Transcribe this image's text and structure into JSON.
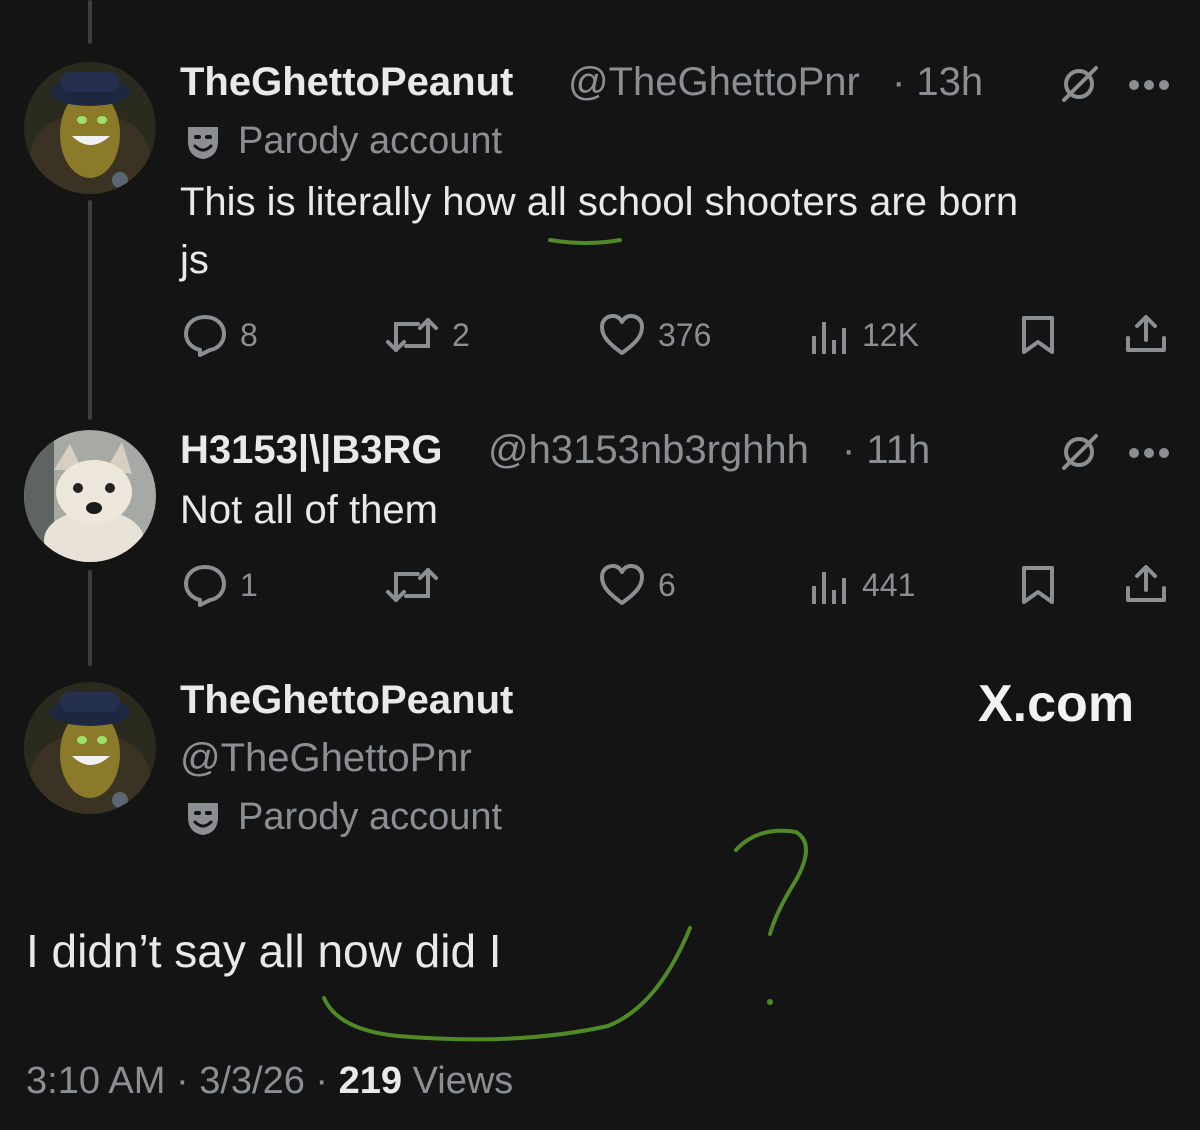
{
  "tweet1": {
    "name": "TheGhettoPeanut",
    "handle": "@TheGhettoPnr",
    "time": "· 13h",
    "label": "Parody account",
    "text_line1": "This is literally how all school shooters are born",
    "text_line2": "js",
    "replies": "8",
    "reposts": "2",
    "likes": "376",
    "views": "12K"
  },
  "tweet2": {
    "name": "H3153|\\|B3RG",
    "handle": "@h3153nb3rghhh",
    "time": "· 11h",
    "text": "Not all of them",
    "replies": "1",
    "reposts": "",
    "likes": "6",
    "views": "441"
  },
  "tweet3": {
    "name": "TheGhettoPeanut",
    "handle": "@TheGhettoPnr",
    "label": "Parody account",
    "text": "I didn’t say all now did I",
    "timestamp": "3:10 AM · 3/3/26 ·",
    "views_count": "219",
    "views_label": "Views"
  },
  "watermark": "X.com",
  "annotation_color": "#4f8a25",
  "icons": [
    "grok-icon",
    "more-icon",
    "reply-icon",
    "repost-icon",
    "like-icon",
    "views-icon",
    "bookmark-icon",
    "share-icon",
    "parody-mask-icon"
  ]
}
